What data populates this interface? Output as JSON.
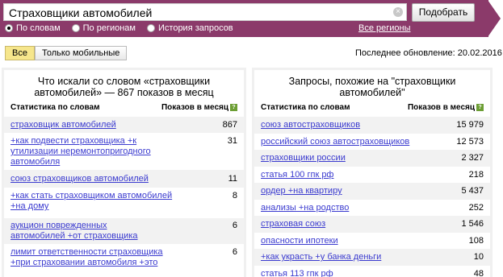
{
  "search": {
    "query": "Страховщики автомобилей",
    "clear_icon": "clear-icon",
    "button": "Подобрать",
    "radios": [
      {
        "label": "По словам",
        "checked": true
      },
      {
        "label": "По регионам",
        "checked": false
      },
      {
        "label": "История запросов",
        "checked": false
      }
    ],
    "all_regions": "Все регионы"
  },
  "filter": {
    "all": "Все",
    "mobile": "Только мобильные"
  },
  "last_update": "Последнее обновление: 20.02.2016",
  "left": {
    "title": "Что искали со словом «страховщики автомобилей» — 867 показов в месяц",
    "col1": "Статистика по словам",
    "col2": "Показов в месяц",
    "rows": [
      {
        "text": "страховщик автомобилей",
        "count": "867"
      },
      {
        "text": "+как подвести страховщика +к утилизации неремонтопригодного автомобиля",
        "count": "31"
      },
      {
        "text": "союз страховщиков автомобилей",
        "count": "11"
      },
      {
        "text": "+как стать страховщиком автомобилей +на дому",
        "count": "8"
      },
      {
        "text": "аукцион поврежденных автомобилей +от страховщика",
        "count": "6"
      },
      {
        "text": "лимит ответственности страховщика +при страховании автомобиля +это",
        "count": "6"
      }
    ]
  },
  "right": {
    "title": "Запросы, похожие на \"страховщики автомобилей\"",
    "col1": "Статистика по словам",
    "col2": "Показов в месяц",
    "rows": [
      {
        "text": "союз автостраховщиков",
        "count": "15 979"
      },
      {
        "text": "российский союз автостраховщиков",
        "count": "12 573"
      },
      {
        "text": "страховщики россии",
        "count": "2 327"
      },
      {
        "text": "статья 100 гпк рф",
        "count": "218"
      },
      {
        "text": "ордер +на квартиру",
        "count": "5 437"
      },
      {
        "text": "анализы +на родство",
        "count": "252"
      },
      {
        "text": "страховая союз",
        "count": "1 546"
      },
      {
        "text": "опасности ипотеки",
        "count": "108"
      },
      {
        "text": "+как украсть +у банка деньги",
        "count": "10"
      },
      {
        "text": "статья 113 гпк рф",
        "count": "48"
      }
    ]
  },
  "colors": {
    "bar": "#8b3a6a",
    "link": "#3a3acf",
    "active_filter": "#f6e68c"
  }
}
